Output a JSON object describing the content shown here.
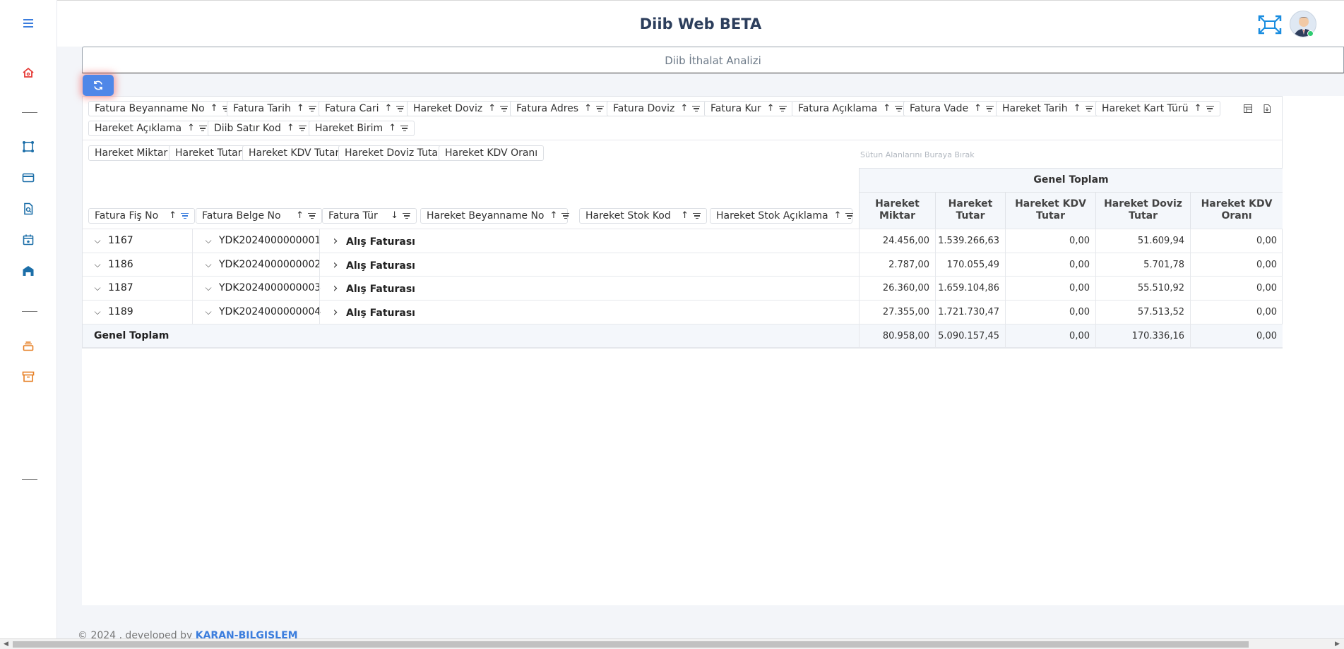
{
  "app": {
    "title": "Diib Web BETA"
  },
  "colors": {
    "accent": "#3b7ddd",
    "danger": "#e53935",
    "teal": "#1b6ea8",
    "orange": "#e67e22",
    "refresh": "#4f87e8"
  },
  "sidebar": {
    "icons": [
      "menu-icon",
      "home-icon",
      "transform-icon",
      "card-icon",
      "search-doc-icon",
      "calendar-icon",
      "warehouse-icon",
      "stack-icon",
      "archive-icon"
    ]
  },
  "page": {
    "tab_title": "Diib İthalat Analizi"
  },
  "pivot": {
    "filter_fields": [
      {
        "label": "Fatura Beyanname No",
        "sort": "↑"
      },
      {
        "label": "Fatura Tarih",
        "sort": "↑"
      },
      {
        "label": "Fatura Cari",
        "sort": "↑"
      },
      {
        "label": "Hareket Doviz",
        "sort": "↑"
      },
      {
        "label": "Fatura Adres",
        "sort": "↑"
      },
      {
        "label": "Fatura Doviz",
        "sort": "↑"
      },
      {
        "label": "Fatura Kur",
        "sort": "↑"
      },
      {
        "label": "Fatura Açıklama",
        "sort": "↑"
      },
      {
        "label": "Fatura Vade",
        "sort": "↑"
      },
      {
        "label": "Hareket Tarih",
        "sort": "↑"
      },
      {
        "label": "Hareket Kart Türü",
        "sort": "↑"
      },
      {
        "label": "Hareket Açıklama",
        "sort": "↑"
      },
      {
        "label": "Diib Satır Kod",
        "sort": "↑"
      },
      {
        "label": "Hareket Birim",
        "sort": "↑"
      }
    ],
    "data_fields": [
      "Hareket Miktar",
      "Hareket Tutar",
      "Hareket KDV Tutar",
      "Hareket Doviz Tutar",
      "Hareket KDV Oranı"
    ],
    "column_drop_hint": "Sütun Alanlarını Buraya Bırak",
    "row_fields": [
      {
        "label": "Fatura Fiş No",
        "sort": "↑"
      },
      {
        "label": "Fatura Belge No",
        "sort": "↑"
      },
      {
        "label": "Fatura Tür",
        "sort": "↓"
      },
      {
        "label": "Hareket Beyanname No",
        "sort": "↑"
      },
      {
        "label": "Hareket Stok Kod",
        "sort": "↑"
      },
      {
        "label": "Hareket Stok Açıklama",
        "sort": "↑"
      }
    ],
    "grand_total_header": "Genel Toplam",
    "measure_headers": [
      [
        "Hareket",
        "Miktar"
      ],
      [
        "Hareket",
        "Tutar"
      ],
      [
        "Hareket KDV",
        "Tutar"
      ],
      [
        "Hareket Doviz",
        "Tutar"
      ],
      [
        "Hareket KDV",
        "Oranı"
      ]
    ],
    "rows": [
      {
        "fis": "1167",
        "belge": "YDK2024000000001",
        "tur": "Alış Faturası",
        "values": [
          "24.456,00",
          "1.539.266,63",
          "0,00",
          "51.609,94",
          "0,00"
        ]
      },
      {
        "fis": "1186",
        "belge": "YDK2024000000002",
        "tur": "Alış Faturası",
        "values": [
          "2.787,00",
          "170.055,49",
          "0,00",
          "5.701,78",
          "0,00"
        ]
      },
      {
        "fis": "1187",
        "belge": "YDK2024000000003",
        "tur": "Alış Faturası",
        "values": [
          "26.360,00",
          "1.659.104,86",
          "0,00",
          "55.510,92",
          "0,00"
        ]
      },
      {
        "fis": "1189",
        "belge": "YDK2024000000004",
        "tur": "Alış Faturası",
        "values": [
          "27.355,00",
          "1.721.730,47",
          "0,00",
          "57.513,52",
          "0,00"
        ]
      }
    ],
    "total": {
      "label": "Genel Toplam",
      "values": [
        "80.958,00",
        "5.090.157,45",
        "0,00",
        "170.336,16",
        "0,00"
      ]
    }
  },
  "footer": {
    "copyright": "© 2024 , developed by",
    "company": "KARAN-BILGISLEM"
  }
}
